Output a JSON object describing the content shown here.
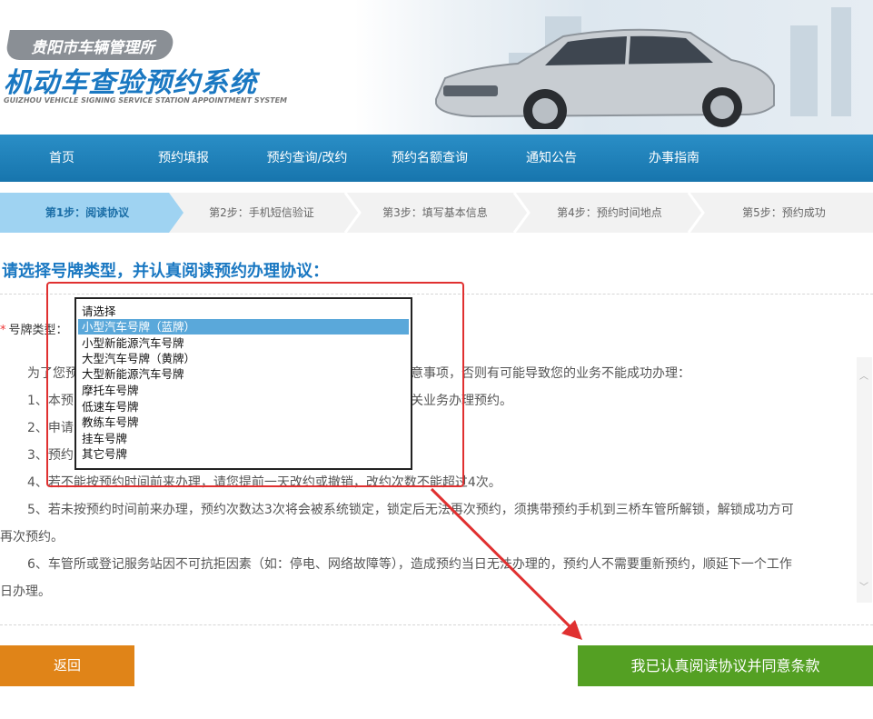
{
  "header": {
    "org_name": "贵阳市车辆管理所",
    "system_title": "机动车查验预约系统",
    "system_subtitle": "GUIZHOU VEHICLE SIGNING SERVICE STATION APPOINTMENT SYSTEM"
  },
  "nav": {
    "items": [
      "首页",
      "预约填报",
      "预约查询/改约",
      "预约名额查询",
      "通知公告",
      "办事指南"
    ]
  },
  "steps": {
    "items": [
      "第1步：阅读协议",
      "第2步：手机短信验证",
      "第3步：填写基本信息",
      "第4步：预约时间地点",
      "第5步：预约成功"
    ],
    "active_index": 0
  },
  "main": {
    "section_title": "请选择号牌类型，并认真阅读预约办理协议：",
    "plate_label": "号牌类型：",
    "required_mark": "*",
    "plate_select": {
      "options": [
        "请选择",
        "小型汽车号牌（蓝牌）",
        "小型新能源汽车号牌",
        "大型汽车号牌（黄牌）",
        "大型新能源汽车号牌",
        "摩托车号牌",
        "低速车号牌",
        "教练车号牌",
        "挂车号牌",
        "其它号牌"
      ],
      "selected_index": 1
    },
    "agreement": {
      "line_intro_left": "为了您预",
      "line_intro_right": "意事项，否则有可能导致您的业务不能成功办理：",
      "line1_left": "1、本预",
      "line1_right": "关业务办理预约。",
      "line2_left": "2、申请",
      "line3_left": "3、预约",
      "line4": "4、若不能按预约时间前来办理，请您提前一天改约或撤销，改约次数不能超过4次。",
      "line5a": "5、若未按预约时间前来办理，预约次数达3次将会被系统锁定，锁定后无法再次预约，须携带预约手机到三桥车管所解锁，解锁成功方可",
      "line5b": "再次预约。",
      "line6a": "6、车管所或登记服务站因不可抗拒因素（如：停电、网络故障等），造成预约当日无法办理的，预约人不需要重新预约，顺延下一个工作",
      "line6b": "日办理。"
    }
  },
  "buttons": {
    "back_label": "返回",
    "agree_label": "我已认真阅读协议并同意条款"
  },
  "colors": {
    "nav_blue": "#1a7fb9",
    "title_blue": "#1a78c2",
    "step_active": "#9fd3f2",
    "back_orange": "#e08418",
    "agree_green": "#54a023",
    "annotation_red": "#e03030"
  }
}
